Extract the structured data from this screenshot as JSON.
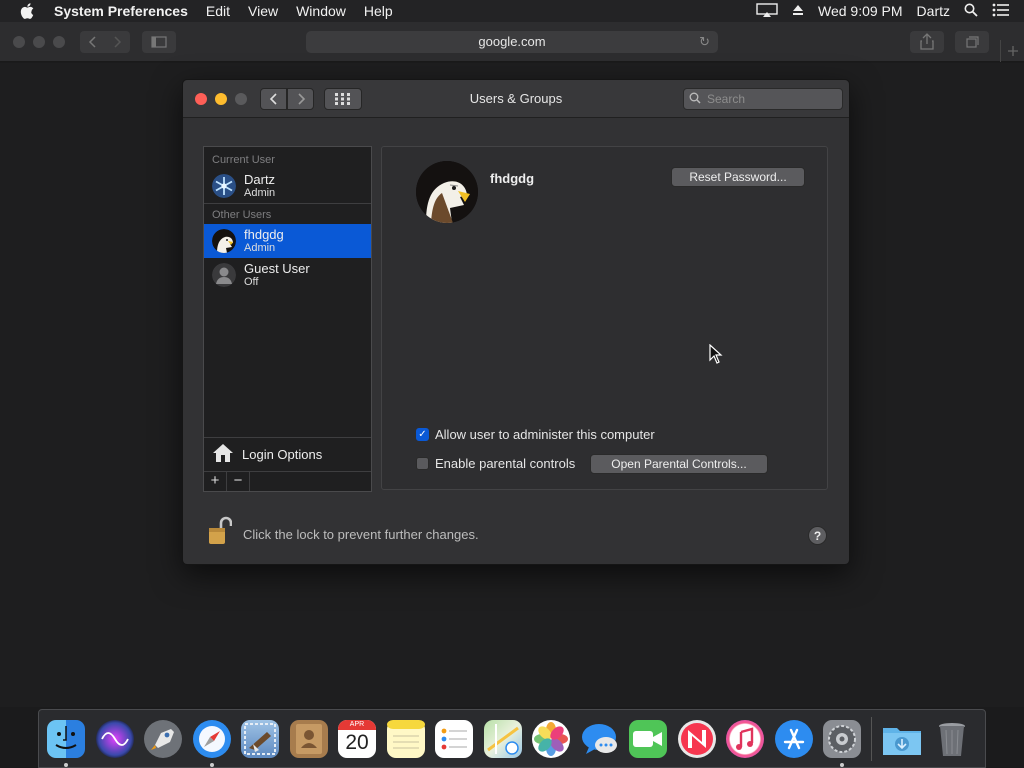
{
  "menubar": {
    "app_name": "System Preferences",
    "menus": [
      "Edit",
      "View",
      "Window",
      "Help"
    ],
    "clock": "Wed 9:09 PM",
    "user": "Dartz"
  },
  "safari": {
    "url": "google.com"
  },
  "window": {
    "title": "Users & Groups",
    "search_placeholder": "Search"
  },
  "sidebar": {
    "current_user_header": "Current User",
    "current_user": {
      "name": "Dartz",
      "role": "Admin"
    },
    "other_users_header": "Other Users",
    "other_users": [
      {
        "name": "fhdgdg",
        "role": "Admin",
        "selected": true
      },
      {
        "name": "Guest User",
        "role": "Off",
        "selected": false
      }
    ],
    "login_options_label": "Login Options",
    "add_label": "+",
    "remove_label": "−"
  },
  "detail": {
    "username": "fhdgdg",
    "reset_password_label": "Reset Password...",
    "allow_admin_label": "Allow user to administer this computer",
    "allow_admin_checked": true,
    "parental_controls_label": "Enable parental controls",
    "parental_controls_checked": false,
    "open_parental_label": "Open Parental Controls..."
  },
  "footer": {
    "lock_text": "Click the lock to prevent further changes.",
    "help_label": "?"
  },
  "calendar_date": "20",
  "calendar_month": "APR",
  "colors": {
    "accent": "#0a59d6",
    "close": "#fe5f57",
    "minimize": "#febc2e",
    "zoom": "#5a5a5c"
  },
  "dock_apps": [
    "finder-icon",
    "siri-icon",
    "launchpad-icon",
    "safari-icon",
    "mail-icon",
    "contacts-icon",
    "calendar-icon",
    "notes-icon",
    "reminders-icon",
    "maps-icon",
    "photos-icon",
    "messages-icon",
    "facetime-icon",
    "news-icon",
    "itunes-icon",
    "app-store-icon",
    "system-preferences-icon",
    "downloads-folder-icon",
    "trash-icon"
  ]
}
